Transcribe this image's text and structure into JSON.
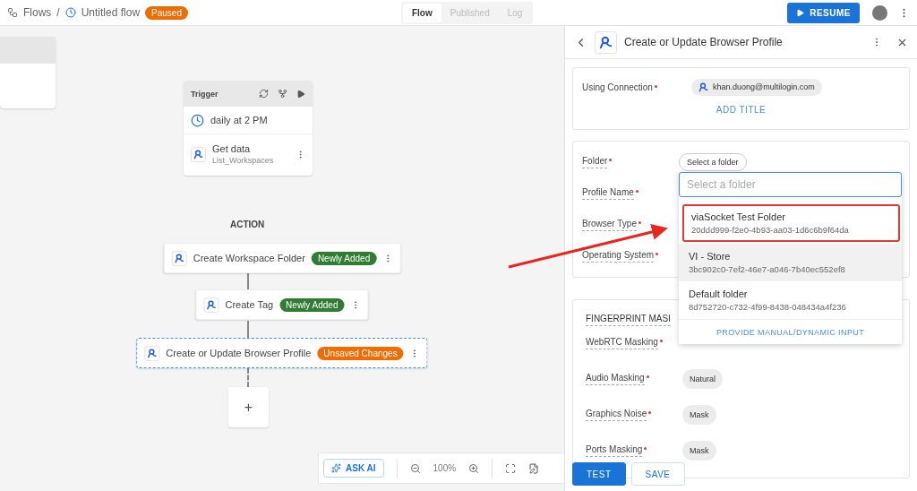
{
  "topbar": {
    "breadcrumb_root": "Flows",
    "separator": "/",
    "flow_name": "Untitled flow",
    "status": "Paused",
    "tabs": [
      {
        "label": "Flow",
        "selected": true
      },
      {
        "label": "Published",
        "selected": false
      },
      {
        "label": "Log",
        "selected": false
      }
    ],
    "resume_button": "RESUME"
  },
  "canvas": {
    "trigger": {
      "title": "Trigger",
      "schedule": "daily at 2 PM",
      "step_title": "Get data",
      "step_subtitle": "List_Workspaces"
    },
    "section_label": "ACTION",
    "actions": [
      {
        "title": "Create Workspace Folder",
        "badge": "Newly Added",
        "color": "#2e7d32",
        "selected": false
      },
      {
        "title": "Create Tag",
        "badge": "Newly Added",
        "color": "#2e7d32",
        "selected": false
      },
      {
        "title": "Create or Update Browser Profile",
        "badge": "Unsaved Changes",
        "color": "#ef6c00",
        "selected": true
      }
    ],
    "add_step": "+",
    "toolbar": {
      "ask_ai": "ASK AI",
      "zoom": "100%"
    }
  },
  "panel": {
    "title": "Create or Update Browser Profile",
    "connection": {
      "label": "Using Connection",
      "required": true,
      "account": "khan.duong@multilogin.com",
      "add_title": "ADD TITLE"
    },
    "fields": [
      {
        "label": "Folder",
        "required": true,
        "value": "Select a folder"
      },
      {
        "label": "Profile Name",
        "required": true
      },
      {
        "label": "Browser Type",
        "required": true
      },
      {
        "label": "Operating System",
        "required": true
      }
    ],
    "dropdown": {
      "placeholder": "Select a folder",
      "options": [
        {
          "name": "viaSocket Test Folder",
          "id": "20ddd999-f2e0-4b93-aa03-1d6c6b9f64da",
          "highlighted": true,
          "hovered": false
        },
        {
          "name": "VI - Store",
          "id": "3bc902c0-7ef2-46e7-a046-7b40ec552ef8",
          "highlighted": false,
          "hovered": true
        },
        {
          "name": "Default folder",
          "id": "8d752720-c732-4f99-8438-048434a4f236",
          "highlighted": false,
          "hovered": false
        }
      ],
      "manual_input": "PROVIDE MANUAL/DYNAMIC INPUT"
    },
    "fingerprint": {
      "title": "FINGERPRINT MASI",
      "fields": [
        {
          "label": "WebRTC Masking",
          "required": true
        },
        {
          "label": "Audio Masking",
          "required": true,
          "value": "Natural"
        },
        {
          "label": "Graphics Noise",
          "required": true,
          "value": "Mask"
        },
        {
          "label": "Ports Masking",
          "required": true,
          "value": "Mask"
        }
      ]
    },
    "buttons": [
      {
        "label": "TEST",
        "kind": "primary"
      },
      {
        "label": "SAVE",
        "kind": "outline"
      }
    ]
  }
}
